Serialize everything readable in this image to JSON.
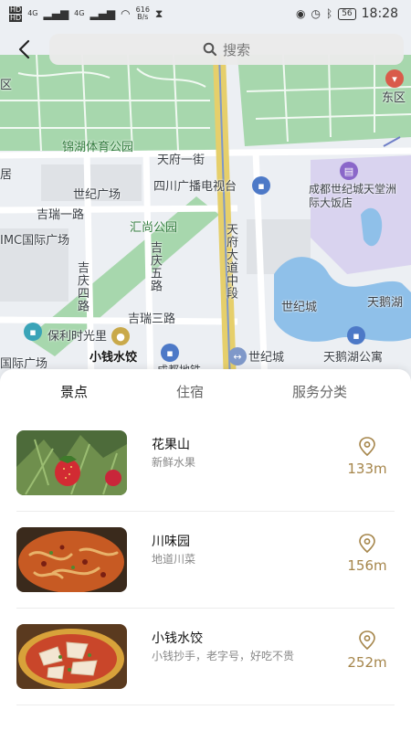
{
  "status_bar": {
    "sim1": "HD",
    "sim2": "HD",
    "net1": "4G",
    "net2": "4G",
    "speed_value": "616",
    "speed_unit": "B/s",
    "battery": "56",
    "time": "18:28"
  },
  "search": {
    "placeholder": "搜索"
  },
  "map": {
    "labels": {
      "jinghu": "锦湖体育公园",
      "tianfu1": "天府一街",
      "sichuan_tv": "四川广播电视台",
      "shijie_hotel": "成都世纪城天堂洲际大饭店",
      "shiji_plaza": "世纪广场",
      "jirui1": "吉瑞一路",
      "imc": "IMC国际广场",
      "huishang": "汇尚公园",
      "jiqing5": "吉庆五路",
      "tianfu_ave": "天府大道中段",
      "jiqing4": "吉庆四路",
      "jirui3": "吉瑞三路",
      "shijicheng": "世纪城",
      "tianehu": "天鹅湖",
      "poly": "保利时光里",
      "xiaoqian": "小钱水饺",
      "shijicheng2": "世纪城",
      "tianehu_apt": "天鹅湖公寓",
      "guoji": "国际广场",
      "dongqu": "东区",
      "quleft": "区",
      "ju": "居",
      "chengdu_metro": "成都地铁"
    }
  },
  "tabs": [
    {
      "label": "景点"
    },
    {
      "label": "住宿"
    },
    {
      "label": "服务分类"
    }
  ],
  "items": [
    {
      "title": "花果山",
      "desc": "新鲜水果",
      "distance": "133m"
    },
    {
      "title": "川味园",
      "desc": "地道川菜",
      "distance": "156m"
    },
    {
      "title": "小钱水饺",
      "desc": "小钱抄手，老字号，好吃不贵",
      "distance": "252m"
    }
  ],
  "colors": {
    "accent_gold": "#a5854a",
    "map_park": "#9fd2a6",
    "map_water": "#8fbfe8",
    "map_road_major": "#e8cf6a",
    "map_purple": "#d9d2ee"
  }
}
